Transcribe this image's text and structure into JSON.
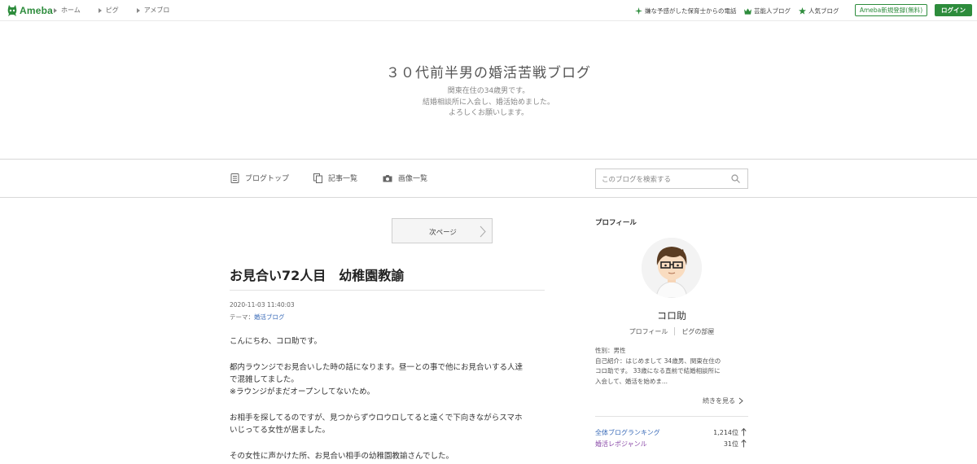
{
  "global_nav": {
    "logo_text": "Ameba",
    "breadcrumbs": [
      "ホーム",
      "ピグ",
      "アメブロ"
    ],
    "links": [
      {
        "label": "嫌な予感がした保育士からの電話",
        "icon": "star-burst-icon"
      },
      {
        "label": "芸能人ブログ",
        "icon": "crown-icon"
      },
      {
        "label": "人気ブログ",
        "icon": "star-icon"
      }
    ],
    "register_label": "Ameba新規登録(無料)",
    "login_label": "ログイン",
    "accent": "#2d8c3c"
  },
  "blog": {
    "title": "３０代前半男の婚活苦戦ブログ",
    "description": [
      "関東在住の34歳男です。",
      "結婚相談所に入会し、婚活始めました。",
      "よろしくお願いします。"
    ]
  },
  "blog_nav": {
    "items": [
      {
        "label": "ブログトップ",
        "icon": "document-icon"
      },
      {
        "label": "記事一覧",
        "icon": "copy-icon"
      },
      {
        "label": "画像一覧",
        "icon": "camera-icon"
      }
    ],
    "search_placeholder": "このブログを検索する"
  },
  "entry": {
    "next_page_label": "次ページ",
    "title": "お見合い72人目　幼稚園教諭",
    "date": "2020-11-03 11:40:03",
    "theme_label": "テーマ：",
    "theme_value": "婚活ブログ",
    "paragraphs": [
      [
        "こんにちわ、コロ助です。"
      ],
      [
        "都内ラウンジでお見合いした時の話になります。昼一との事で他にお見合いする人達",
        "で混雑してました。",
        "※ラウンジがまだオープンしてないため。"
      ],
      [
        "お相手を探してるのですが、見つからずウロウロしてると遠くで下向きながらスマホ",
        "いじってる女性が居ました。"
      ],
      [
        "その女性に声かけた所、お見合い相手の幼稚園教諭さんでした。"
      ]
    ]
  },
  "sidebar": {
    "heading": "プロフィール",
    "name": "コロ助",
    "links": [
      "プロフィール",
      "ピグの部屋"
    ],
    "profile_lines": [
      "性別：男性",
      "自己紹介：はじめまして 34歳男、関東在住の",
      "コロ助です。 33歳になる直前で結婚相談所に",
      "入会して、婚活を始めま..."
    ],
    "more_label": "続きを見る",
    "rankings": [
      {
        "label": "全体ブログランキング",
        "value": "1,214位",
        "color": "#3a6bb8"
      },
      {
        "label": "婚活レポジャンル",
        "value": "31位",
        "color": "#8a4aa8"
      }
    ]
  }
}
